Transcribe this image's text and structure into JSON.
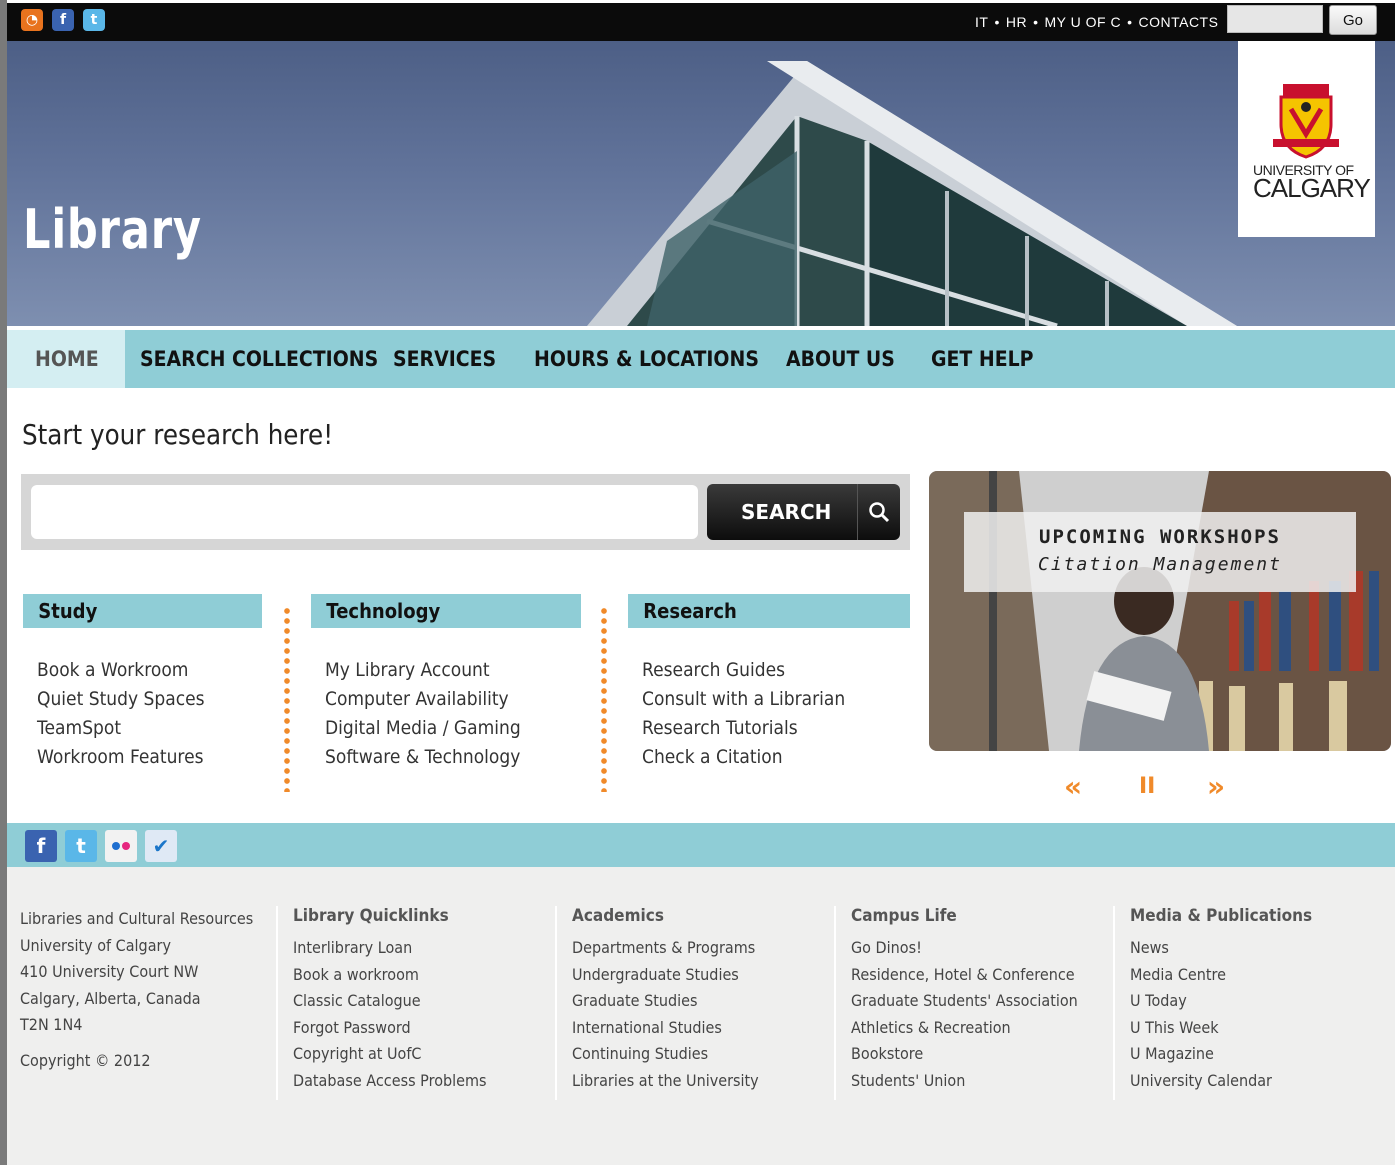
{
  "topbar": {
    "social": [
      "rss-icon",
      "facebook-icon",
      "twitter-icon"
    ],
    "links": [
      "IT",
      "HR",
      "MY U OF C",
      "CONTACTS"
    ],
    "search_placeholder": "",
    "go_label": "Go"
  },
  "banner": {
    "title": "Library",
    "logo_line1": "UNIVERSITY OF",
    "logo_line2": "CALGARY"
  },
  "nav": {
    "items": [
      "HOME",
      "SEARCH COLLECTIONS",
      "SERVICES",
      "HOURS & LOCATIONS",
      "ABOUT US",
      "GET HELP"
    ],
    "active": "HOME"
  },
  "main": {
    "heading": "Start your research here!",
    "search_button": "SEARCH",
    "columns": [
      {
        "title": "Study",
        "links": [
          "Book a Workroom",
          "Quiet Study Spaces",
          "TeamSpot",
          "Workroom Features"
        ]
      },
      {
        "title": "Technology",
        "links": [
          "My Library Account",
          "Computer Availability",
          "Digital Media / Gaming",
          "Software & Technology"
        ]
      },
      {
        "title": "Research",
        "links": [
          "Research Guides",
          "Consult with a Librarian",
          "Research Tutorials",
          "Check a Citation"
        ]
      }
    ]
  },
  "slideshow": {
    "title": "UPCOMING WORKSHOPS",
    "subtitle": "Citation Management",
    "controls": {
      "prev": "«",
      "pause": "II",
      "next": "»"
    }
  },
  "social_strip": [
    "facebook-icon",
    "twitter-icon",
    "flickr-icon",
    "foursquare-icon"
  ],
  "footer": {
    "address": [
      "Libraries and Cultural Resources",
      "University of Calgary",
      "410 University Court NW",
      "Calgary, Alberta, Canada",
      "T2N 1N4"
    ],
    "copyright": "Copyright © 2012",
    "columns": [
      {
        "title": "Library Quicklinks",
        "links": [
          "Interlibrary Loan",
          "Book a workroom",
          "Classic Catalogue",
          "Forgot Password",
          "Copyright at UofC",
          "Database Access Problems"
        ]
      },
      {
        "title": "Academics",
        "links": [
          "Departments & Programs",
          "Undergraduate Studies",
          "Graduate Studies",
          "International Studies",
          "Continuing Studies",
          "Libraries at the University"
        ]
      },
      {
        "title": "Campus Life",
        "links": [
          "Go Dinos!",
          "Residence, Hotel & Conference",
          "Graduate Students' Association",
          "Athletics & Recreation",
          "Bookstore",
          "Students' Union"
        ]
      },
      {
        "title": "Media & Publications",
        "links": [
          "News",
          "Media Centre",
          "U Today",
          "U This Week",
          "U Magazine",
          "University Calendar"
        ]
      }
    ]
  },
  "colors": {
    "nav_bg": "#8fcdd6",
    "nav_active_bg": "#d4eef2",
    "accent_orange": "#f08a2a",
    "topbar_bg": "#0b0b0b",
    "footer_bg": "#efefee"
  }
}
